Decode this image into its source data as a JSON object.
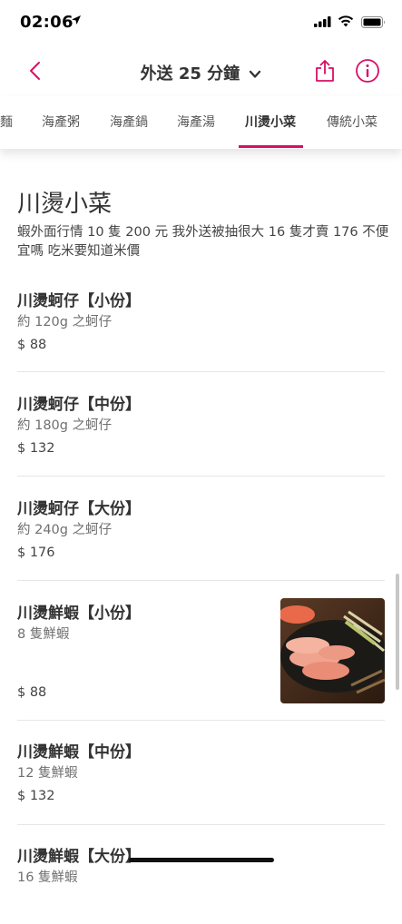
{
  "status_bar": {
    "time": "02:06"
  },
  "nav": {
    "title": "外送 25 分鐘",
    "accent_color": "#d70f64"
  },
  "tabs": [
    {
      "label": "麵",
      "active": false
    },
    {
      "label": "海產粥",
      "active": false
    },
    {
      "label": "海產鍋",
      "active": false
    },
    {
      "label": "海產湯",
      "active": false
    },
    {
      "label": "川燙小菜",
      "active": true
    },
    {
      "label": "傳統小菜",
      "active": false
    }
  ],
  "section": {
    "title": "川燙小菜",
    "description": "蝦外面行情 10 隻 200 元 我外送被抽很大 16 隻才賣 176 不便宜嗎 吃米要知道米價"
  },
  "items": [
    {
      "name": "川燙蚵仔【小份】",
      "desc": "約 120g 之蚵仔",
      "price": "$ 88"
    },
    {
      "name": "川燙蚵仔【中份】",
      "desc": "約 180g 之蚵仔",
      "price": "$ 132"
    },
    {
      "name": "川燙蚵仔【大份】",
      "desc": "約 240g 之蚵仔",
      "price": "$ 176"
    },
    {
      "name": "川燙鮮蝦【小份】",
      "desc": "8 隻鮮蝦",
      "price": "$ 88",
      "image": "boiled-shrimp-photo"
    },
    {
      "name": "川燙鮮蝦【中份】",
      "desc": "12 隻鮮蝦",
      "price": "$ 132"
    },
    {
      "name": "川燙鮮蝦【大份】",
      "desc": "16 隻鮮蝦",
      "price": ""
    }
  ]
}
